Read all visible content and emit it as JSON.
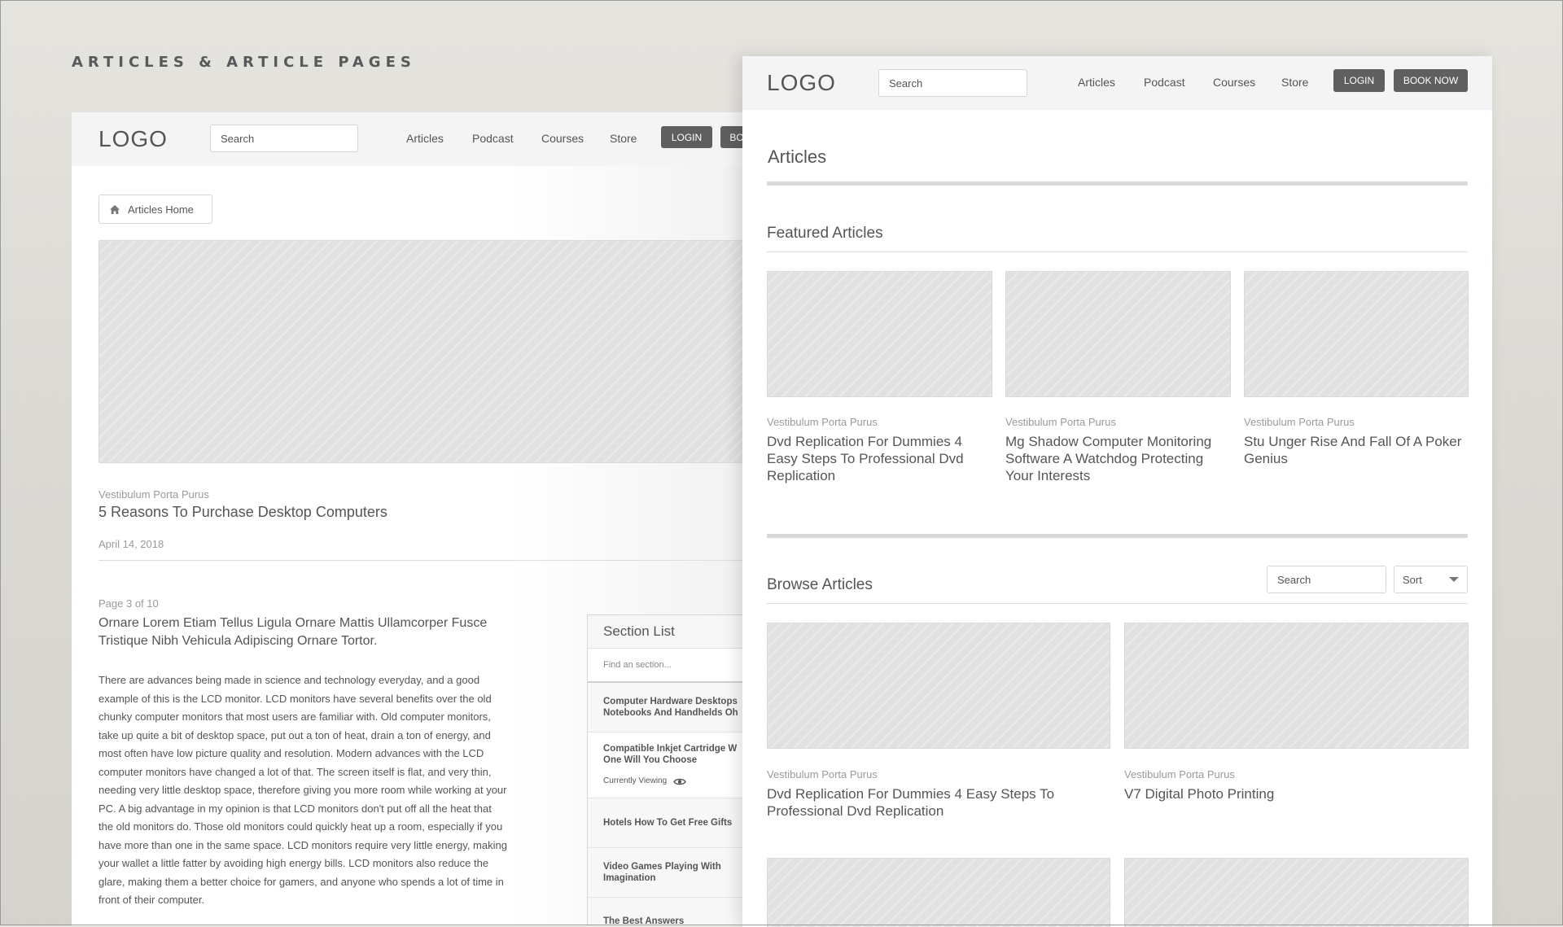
{
  "page": {
    "title": "ARTICLES & ARTICLE PAGES"
  },
  "left": {
    "header": {
      "logo": "LOGO",
      "search_placeholder": "Search",
      "nav": [
        "Articles",
        "Podcast",
        "Courses",
        "Store"
      ],
      "login": "LOGIN",
      "book": "BOOK NOW"
    },
    "breadcrumb": "Articles Home",
    "category": "Vestibulum Porta Purus",
    "title": "5 Reasons To Purchase Desktop Computers",
    "date": "April 14, 2018",
    "page_indicator": "Page 3 of 10",
    "heading": "Ornare Lorem Etiam Tellus Ligula Ornare Mattis Ullamcorper Fusce Tristique Nibh Vehicula Adipiscing Ornare Tortor.",
    "body_lines": [
      "There are advances being made in science and technology everyday, and a good",
      "example of this is the LCD monitor. LCD monitors have several benefits over the old",
      "chunky computer monitors that most users are familiar with. Old computer monitors,",
      "take up quite a bit of desktop space, put out a ton of heat, drain a ton of energy, and",
      "most often have low picture quality and resolution. Modern advances with the LCD",
      "computer monitors have changed a lot of that. The screen itself is flat, and very thin,",
      "needing very little desktop space, therefore giving you more room while working at your",
      "PC. A big advantage in my opinion is that LCD monitors don't put off all the heat that",
      "the old monitors do. Those old monitors could quickly heat up a room, especially if you",
      "have more than one in the same space. LCD monitors require very little energy, making",
      "your wallet a little fatter by avoiding high energy bills. LCD monitors also reduce the",
      "glare, making them a better choice for gamers, and anyone who spends a lot of time in",
      "front of their computer."
    ],
    "section_list": {
      "title": "Section List",
      "find_placeholder": "Find an section...",
      "items": [
        {
          "line1": "Computer Hardware Desktops",
          "line2": "Notebooks And Handhelds Oh"
        },
        {
          "line1": "Compatible Inkjet Cartridge W",
          "line2": "One Will You Choose",
          "status": "Currently Viewing"
        },
        {
          "line1": "Hotels How To Get Free Gifts",
          "line2": ""
        },
        {
          "line1": "Video Games Playing With",
          "line2": "Imagination"
        },
        {
          "line1": "The Best Answers",
          "line2": ""
        }
      ]
    }
  },
  "right": {
    "header": {
      "logo": "LOGO",
      "search_placeholder": "Search",
      "nav": [
        "Articles",
        "Podcast",
        "Courses",
        "Store"
      ],
      "login": "LOGIN",
      "book": "BOOK NOW"
    },
    "page_title": "Articles",
    "featured": {
      "title": "Featured Articles",
      "cards": [
        {
          "category": "Vestibulum Porta Purus",
          "title": [
            "Dvd Replication For Dummies 4",
            "Easy Steps To Professional Dvd",
            "Replication"
          ]
        },
        {
          "category": "Vestibulum Porta Purus",
          "title": [
            "Mg Shadow Computer Monitoring",
            "Software A Watchdog Protecting",
            "Your Interests"
          ]
        },
        {
          "category": "Vestibulum Porta Purus",
          "title": [
            "Stu Unger Rise And Fall Of A Poker",
            "Genius"
          ]
        }
      ]
    },
    "browse": {
      "title": "Browse Articles",
      "search_placeholder": "Search",
      "sort_label": "Sort",
      "cards": [
        {
          "category": "Vestibulum Porta Purus",
          "title": [
            "Dvd Replication For Dummies 4 Easy Steps To",
            "Professional Dvd Replication"
          ]
        },
        {
          "category": "Vestibulum Porta Purus",
          "title": [
            "V7 Digital Photo Printing"
          ]
        }
      ]
    }
  }
}
